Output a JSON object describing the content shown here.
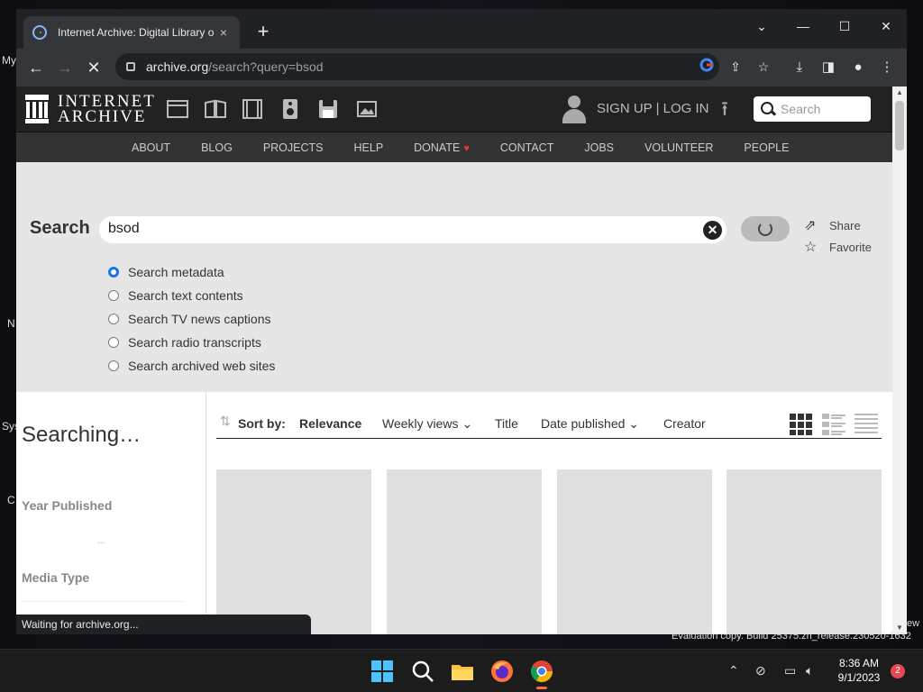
{
  "browser": {
    "tab_title": "Internet Archive: Digital Library o",
    "tab_close": "×",
    "new_tab": "+",
    "window_controls": [
      "⌄",
      "—",
      "☐",
      "✕"
    ],
    "url_host": "archive.org",
    "url_path": "/search?query=bsod",
    "status_text": "Waiting for archive.org..."
  },
  "ia": {
    "logo_line1": "INTERNET",
    "logo_line2": "ARCHIVE",
    "media_icons": [
      "web-icon",
      "texts-icon",
      "video-icon",
      "audio-icon",
      "software-icon",
      "images-icon"
    ],
    "signup_label": "SIGN UP | LOG IN",
    "search_placeholder": "Search",
    "nav": [
      "ABOUT",
      "BLOG",
      "PROJECTS",
      "HELP",
      "DONATE",
      "CONTACT",
      "JOBS",
      "VOLUNTEER",
      "PEOPLE"
    ]
  },
  "search": {
    "label": "Search",
    "query": "bsod",
    "share_label": "Share",
    "favorite_label": "Favorite",
    "options": [
      {
        "label": "Search metadata",
        "selected": true
      },
      {
        "label": "Search text contents",
        "selected": false
      },
      {
        "label": "Search TV news captions",
        "selected": false
      },
      {
        "label": "Search radio transcripts",
        "selected": false
      },
      {
        "label": "Search archived web sites",
        "selected": false
      }
    ]
  },
  "results": {
    "searching_text": "Searching…",
    "facet_year": "Year Published",
    "facet_dots": "...",
    "facet_media": "Media Type",
    "sort_label": "Sort by:",
    "sort_options": [
      "Relevance",
      "Weekly views",
      "Title",
      "Date published",
      "Creator"
    ]
  },
  "desktop": {
    "frag_my": "My",
    "frag_n": "N",
    "frag_sys": "Sys",
    "frag_c": "C",
    "frag_ew": "ew",
    "watermark": "Evaluation copy. Build 25375.zn_release.230520-1632"
  },
  "taskbar": {
    "time": "8:36 AM",
    "date": "9/1/2023",
    "notification_count": "2"
  },
  "colors": {
    "ia_header": "#222222",
    "ia_nav": "#333333",
    "search_bg": "#e6e6e6",
    "radio_accent": "#1a73e8"
  }
}
